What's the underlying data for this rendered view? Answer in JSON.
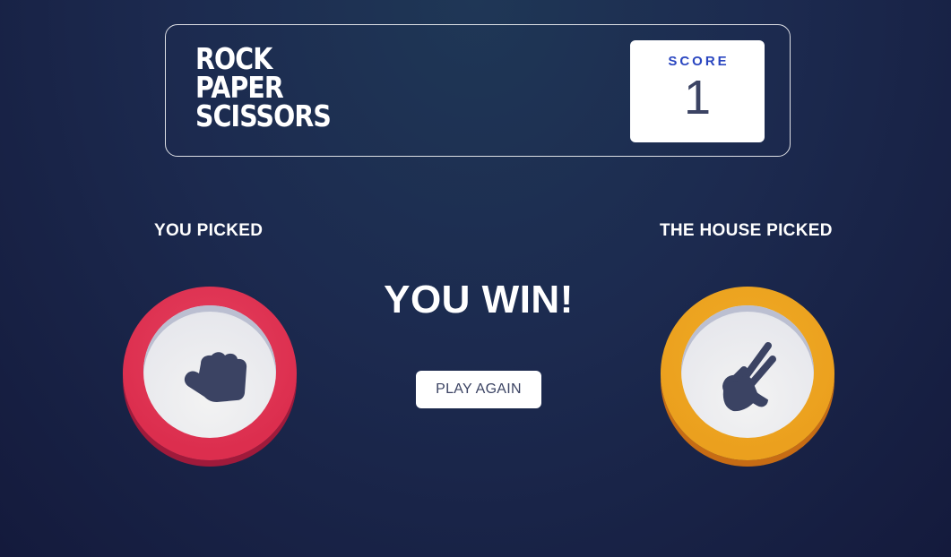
{
  "header": {
    "title_lines": [
      "ROCK",
      "PAPER",
      "SCISSORS"
    ],
    "score_label": "SCORE",
    "score_value": "1"
  },
  "game": {
    "player_label": "YOU PICKED",
    "house_label": "THE HOUSE PICKED",
    "player_choice": {
      "name": "rock",
      "icon": "rock-fist-icon",
      "color": "#dc2e4e"
    },
    "house_choice": {
      "name": "scissors",
      "icon": "scissors-hand-icon",
      "color": "#eba01e"
    },
    "result_text": "YOU WIN!",
    "play_again_label": "PLAY AGAIN"
  },
  "colors": {
    "background_top": "#1f3756",
    "background_bottom": "#141a3c",
    "score_label": "#2a46c0",
    "dark_text": "#3b4363"
  }
}
